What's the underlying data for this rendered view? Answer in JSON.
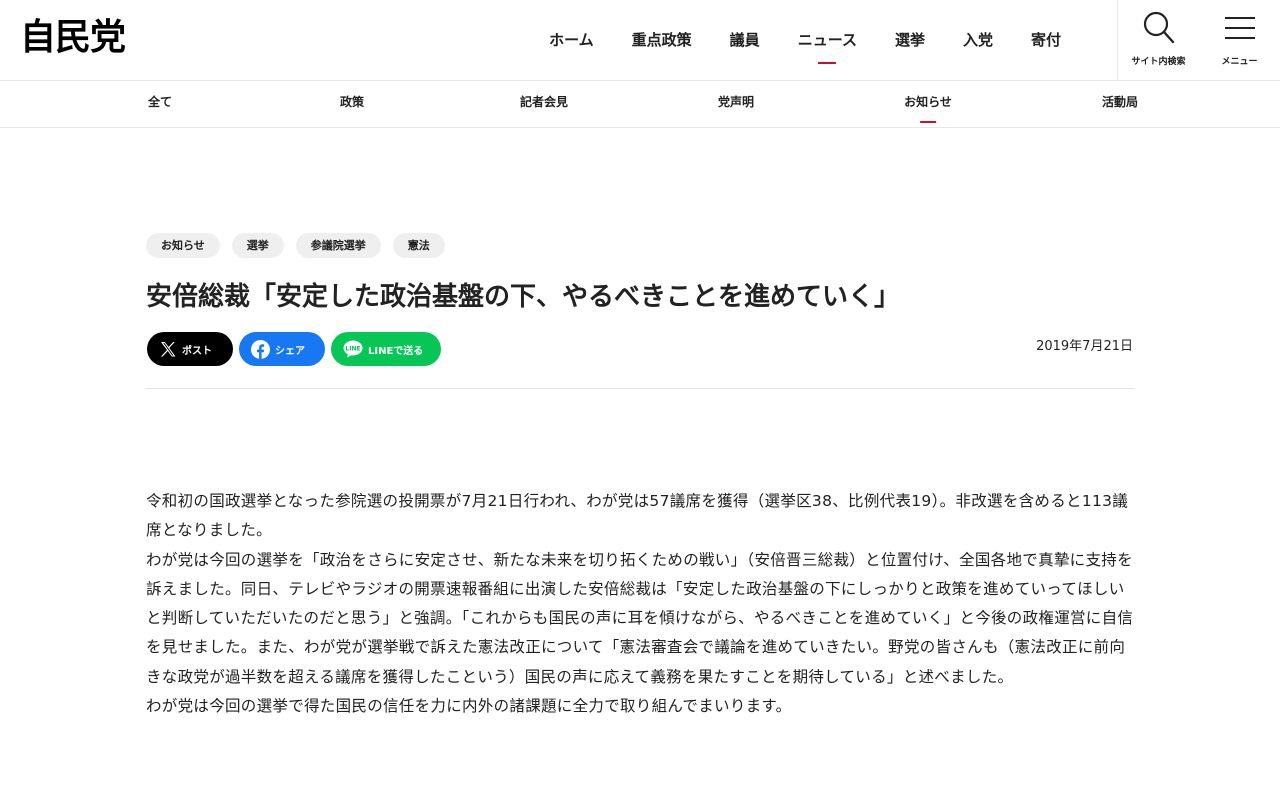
{
  "header": {
    "logo": "自民党",
    "nav": [
      "ホーム",
      "重点政策",
      "議員",
      "ニュース",
      "選挙",
      "入党",
      "寄付"
    ],
    "active_nav": "ニュース",
    "search_label": "サイト内検索",
    "menu_label": "メニュー"
  },
  "subnav": {
    "items": [
      "全て",
      "政策",
      "記者会見",
      "党声明",
      "お知らせ",
      "活動局"
    ],
    "active": "お知らせ"
  },
  "article": {
    "tags": [
      "お知らせ",
      "選挙",
      "参議院選挙",
      "憲法"
    ],
    "title": "安倍総裁「安定した政治基盤の下、やるべきことを進めていく」",
    "share": {
      "x_label": "ポスト",
      "facebook_label": "シェア",
      "line_label": "LINEで送る"
    },
    "date": "2019年7月21日",
    "paragraphs": [
      "令和初の国政選挙となった参院選の投開票が7月21日行われ、わが党は57議席を獲得（選挙区38、比例代表19）。非改選を含めると113議席となりました。",
      "わが党は今回の選挙を「政治をさらに安定させ、新たな未来を切り拓くための戦い」（安倍晋三総裁）と位置付け、全国各地で真摯に支持を訴えました。同日、テレビやラジオの開票速報番組に出演した安倍総裁は「安定した政治基盤の下にしっかりと政策を進めていってほしいと判断していただいたのだと思う」と強調。「これからも国民の声に耳を傾けながら、やるべきことを進めていく」と今後の政権運営に自信を見せました。また、わが党が選挙戦で訴えた憲法改正について「憲法審査会で議論を進めていきたい。野党の皆さんも（憲法改正に前向きな政党が過半数を超える議席を獲得したこという）国民の声に応えて義務を果たすことを期待している」と述べました。",
      "わが党は今回の選挙で得た国民の信任を力に内外の諸課題に全力で取り組んでまいります。"
    ]
  },
  "colors": {
    "accent": "#c8102e",
    "x": "#000000",
    "facebook": "#1877f2",
    "line": "#06c755"
  }
}
